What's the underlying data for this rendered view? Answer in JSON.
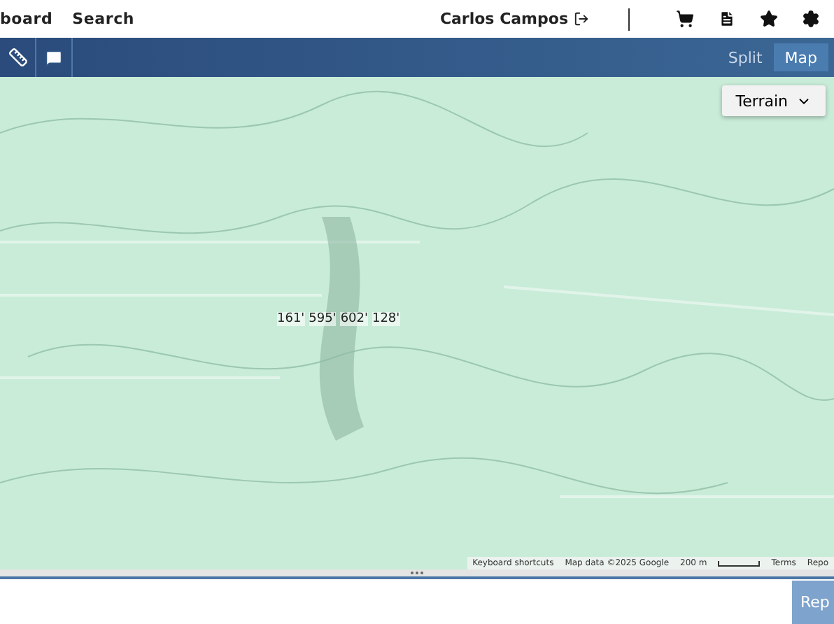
{
  "nav": {
    "links": [
      "board",
      "Search"
    ],
    "user": "Carlos Campos"
  },
  "toolbar": {
    "views": [
      {
        "label": "Split",
        "selected": false
      },
      {
        "label": "Map",
        "selected": true
      }
    ]
  },
  "map": {
    "type_control": "Terrain",
    "measurements": [
      "161'",
      "595'",
      "602'",
      "128'"
    ],
    "attribution": [
      "Keyboard shortcuts",
      "Map data ©2025 Google",
      "200 m",
      "Terms",
      "Repo"
    ]
  },
  "footer": {
    "button": "Rep"
  }
}
